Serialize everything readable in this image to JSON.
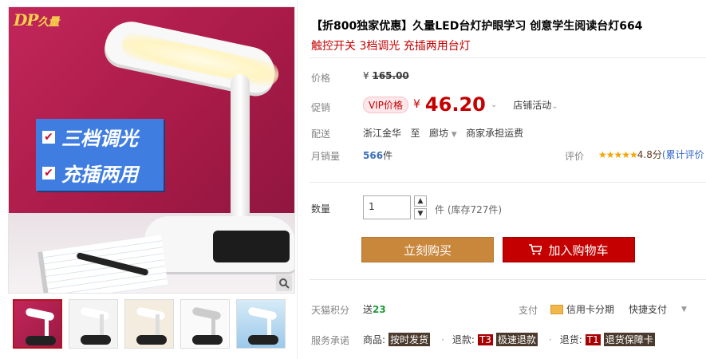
{
  "gallery": {
    "logo_text": "DP久量",
    "banner_lines": [
      "三档调光",
      "充插两用"
    ],
    "thumbs": 5,
    "thumb_banner": "三档调光"
  },
  "product": {
    "title": "【折800独家优惠】久量LED台灯护眼学习 创意学生阅读台灯664",
    "subtitle": "触控开关 3档调光 充插两用台灯"
  },
  "price": {
    "label": "价格",
    "currency": "¥",
    "original": "165.00"
  },
  "promo": {
    "label": "促销",
    "vip_label": "VIP价格",
    "currency": "¥",
    "price": "46.20",
    "store_activity": "店铺活动"
  },
  "shipping": {
    "label": "配送",
    "from": "浙江金华",
    "to_word": "至",
    "dest": "廊坊",
    "fee": "商家承担运费"
  },
  "sales": {
    "label": "月销量",
    "count": "566",
    "unit": "件"
  },
  "rating": {
    "label": "评价",
    "stars": "★★★★★",
    "score": "4.8分",
    "link": "(累计评价"
  },
  "quantity": {
    "label": "数量",
    "value": "1",
    "unit_stock": "件 (库存727件)"
  },
  "buttons": {
    "buy_now": "立刻购买",
    "add_cart": "加入购物车"
  },
  "points": {
    "label": "天猫积分",
    "prefix": "送",
    "value": "23"
  },
  "payment": {
    "label": "支付",
    "credit": "信用卡分期",
    "quick": "快捷支付"
  },
  "service": {
    "label": "服务承诺",
    "goods_prefix": "商品:",
    "goods_tag": "按时发货",
    "refund_prefix": "退款:",
    "refund_code": "T3",
    "refund_tag": "极速退款",
    "return_prefix": "退货:",
    "return_code": "T1",
    "return_tag": "退货保障卡"
  },
  "colors": {
    "accent_red": "#c40000",
    "buy_orange": "#c9873c",
    "cart_red": "#c40000",
    "banner_blue": "#3f7de0",
    "bg_magenta": "#b8214f"
  }
}
